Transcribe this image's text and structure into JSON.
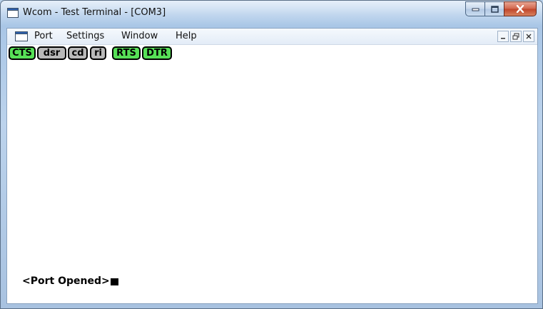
{
  "window": {
    "title": "Wcom - Test Terminal - [COM3]",
    "buttons": {
      "minimize_icon": "minimize-icon",
      "maximize_icon": "maximize-icon",
      "close_icon": "close-icon"
    }
  },
  "menu": {
    "items": [
      {
        "label": "Port"
      },
      {
        "label": "Settings"
      },
      {
        "label": "Window"
      },
      {
        "label": "Help"
      }
    ]
  },
  "indicators": [
    {
      "label": "CTS",
      "active": true
    },
    {
      "label": "dsr",
      "active": false
    },
    {
      "label": "cd",
      "active": false
    },
    {
      "label": "ri",
      "active": false
    },
    {
      "label": "RTS",
      "active": true
    },
    {
      "label": "DTR",
      "active": true
    }
  ],
  "terminal": {
    "text": "<Port Opened>"
  },
  "colors": {
    "indicator_on": "#57e157",
    "indicator_off": "#b9b9b9",
    "close_button": "#c9482e"
  }
}
